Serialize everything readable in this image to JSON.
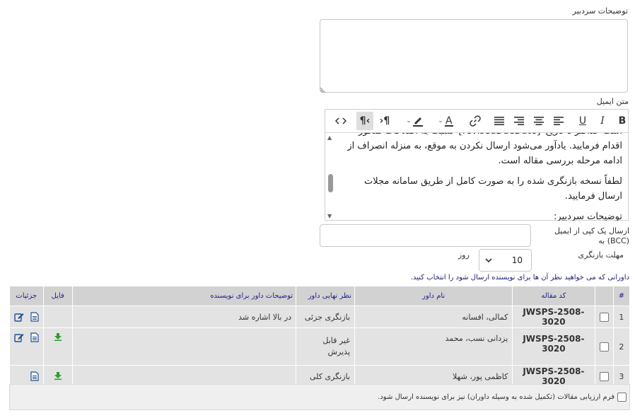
{
  "editor_notes": {
    "label": "توضیحات سردبیر",
    "value": ""
  },
  "email_text": {
    "label": "متن ایمیل",
    "toolbar": [
      {
        "name": "bold-icon",
        "glyph": "B"
      },
      {
        "name": "italic-icon",
        "glyph": "I"
      },
      {
        "name": "underline-icon",
        "glyph": "U"
      },
      {
        "name": "align-left-icon",
        "glyph": "≡"
      },
      {
        "name": "align-center-icon",
        "glyph": "≡"
      },
      {
        "name": "align-right-icon",
        "glyph": "≡"
      },
      {
        "name": "align-justify-icon",
        "glyph": "≡"
      },
      {
        "name": "link-icon",
        "glyph": "🔗"
      },
      {
        "name": "font-color-icon",
        "glyph": "A"
      },
      {
        "name": "highlight-icon",
        "glyph": "✎"
      },
      {
        "name": "ltr-icon",
        "glyph": "¶"
      },
      {
        "name": "rtl-icon",
        "glyph": "¶"
      },
      {
        "name": "source-code-icon",
        "glyph": "<>"
      }
    ],
    "paragraphs": [
      "است حداکثر تا تاریخ {revisedDueDate} نسبت به اصلاحات مذکور اقدام فرمایید. یادآور می‌شود ارسال نکردن به موقع، به منزله انصراف از ادامه مرحله بررسی مقاله است.",
      "لطفاً نسخه بازنگری شده را به صورت کامل از طریق سامانه مجلات ارسال فرمایید.",
      "توضیحات سردبیر:"
    ]
  },
  "bcc": {
    "label_line1": "ارسال یک کپی از ایمیل",
    "label_line2": "(BCC) به",
    "value": ""
  },
  "deadline": {
    "label": "مهلت بازنگری",
    "value": "10",
    "unit": "روز"
  },
  "reviewers_instruction": "داورانی که می خواهید نظر آن ها برای نویسنده ارسال شود را انتخاب کنید.",
  "table": {
    "headers": [
      "#",
      "کد مقاله",
      "نام داور",
      "نظر نهایی داور",
      "توضیحات داور برای نویسنده",
      "فایل",
      "جزئیات"
    ],
    "rows": [
      {
        "num": "1",
        "code": "JWSPS-2508-3020",
        "reviewer": "کمالی، افسانه",
        "decision": "بازنگری جزئی",
        "comment": "در بالا اشاره شد",
        "has_file": false
      },
      {
        "num": "2",
        "code": "JWSPS-2508-3020",
        "reviewer": "یزدانی نسب، محمد",
        "decision": "غیر قابل پذیرش",
        "comment": "",
        "has_file": true
      },
      {
        "num": "3",
        "code": "JWSPS-2508-3020",
        "reviewer": "کاظمی پور، شهلا",
        "decision": "بازنگری کلی",
        "comment": "",
        "has_file": true
      }
    ]
  },
  "footer_checkbox_label": "فرم ارزیابی مقالات (تکمیل شده به وسیله داوران) نیز برای نویسنده ارسال شود.",
  "colors": {
    "header_bg": "#d2d2d2",
    "row_bg": "#e3e3e3",
    "header_text": "#1f1f8f",
    "download_green": "#2e9e2e",
    "icon_blue": "#1f4f8f"
  }
}
